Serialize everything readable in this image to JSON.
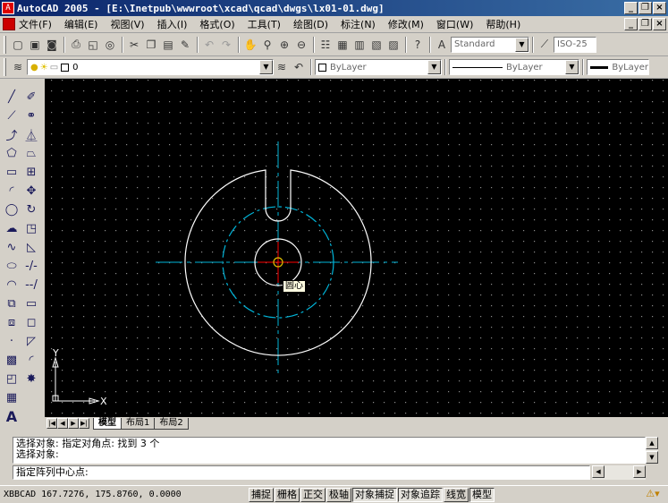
{
  "window": {
    "title": "AutoCAD 2005 - [E:\\Inetpub\\wwwroot\\xcad\\qcad\\dwgs\\lx01-01.dwg]"
  },
  "menu": {
    "items": [
      "文件(F)",
      "编辑(E)",
      "视图(V)",
      "插入(I)",
      "格式(O)",
      "工具(T)",
      "绘图(D)",
      "标注(N)",
      "修改(M)",
      "窗口(W)",
      "帮助(H)"
    ]
  },
  "toolbar": {
    "textstyle": "Standard",
    "dimstyle": "ISO-25"
  },
  "properties": {
    "layer": "0",
    "color": "ByLayer",
    "linetype": "ByLayer",
    "lineweight": "ByLayer"
  },
  "layout_tabs": [
    "模型",
    "布局1",
    "布局2"
  ],
  "tooltip": "圆心",
  "ucs": {
    "x_label": "X",
    "y_label": "Y"
  },
  "command": {
    "history": [
      "选择对象: 指定对角点: 找到 3 个",
      "选择对象:"
    ],
    "prompt": "指定阵列中心点:"
  },
  "status": {
    "prefix": "XBBCAD",
    "coords": "167.7276, 175.8760, 0.0000",
    "toggles": [
      "捕捉",
      "栅格",
      "正交",
      "极轴",
      "对象捕捉",
      "对象追踪",
      "线宽",
      "模型"
    ],
    "active": [
      "对象捕捉",
      "对象追踪",
      "模型"
    ]
  },
  "colors": {
    "background": "#000000",
    "geometry": "#ffffff",
    "centerline": "#00b4d8",
    "axis": "#ff0000"
  }
}
